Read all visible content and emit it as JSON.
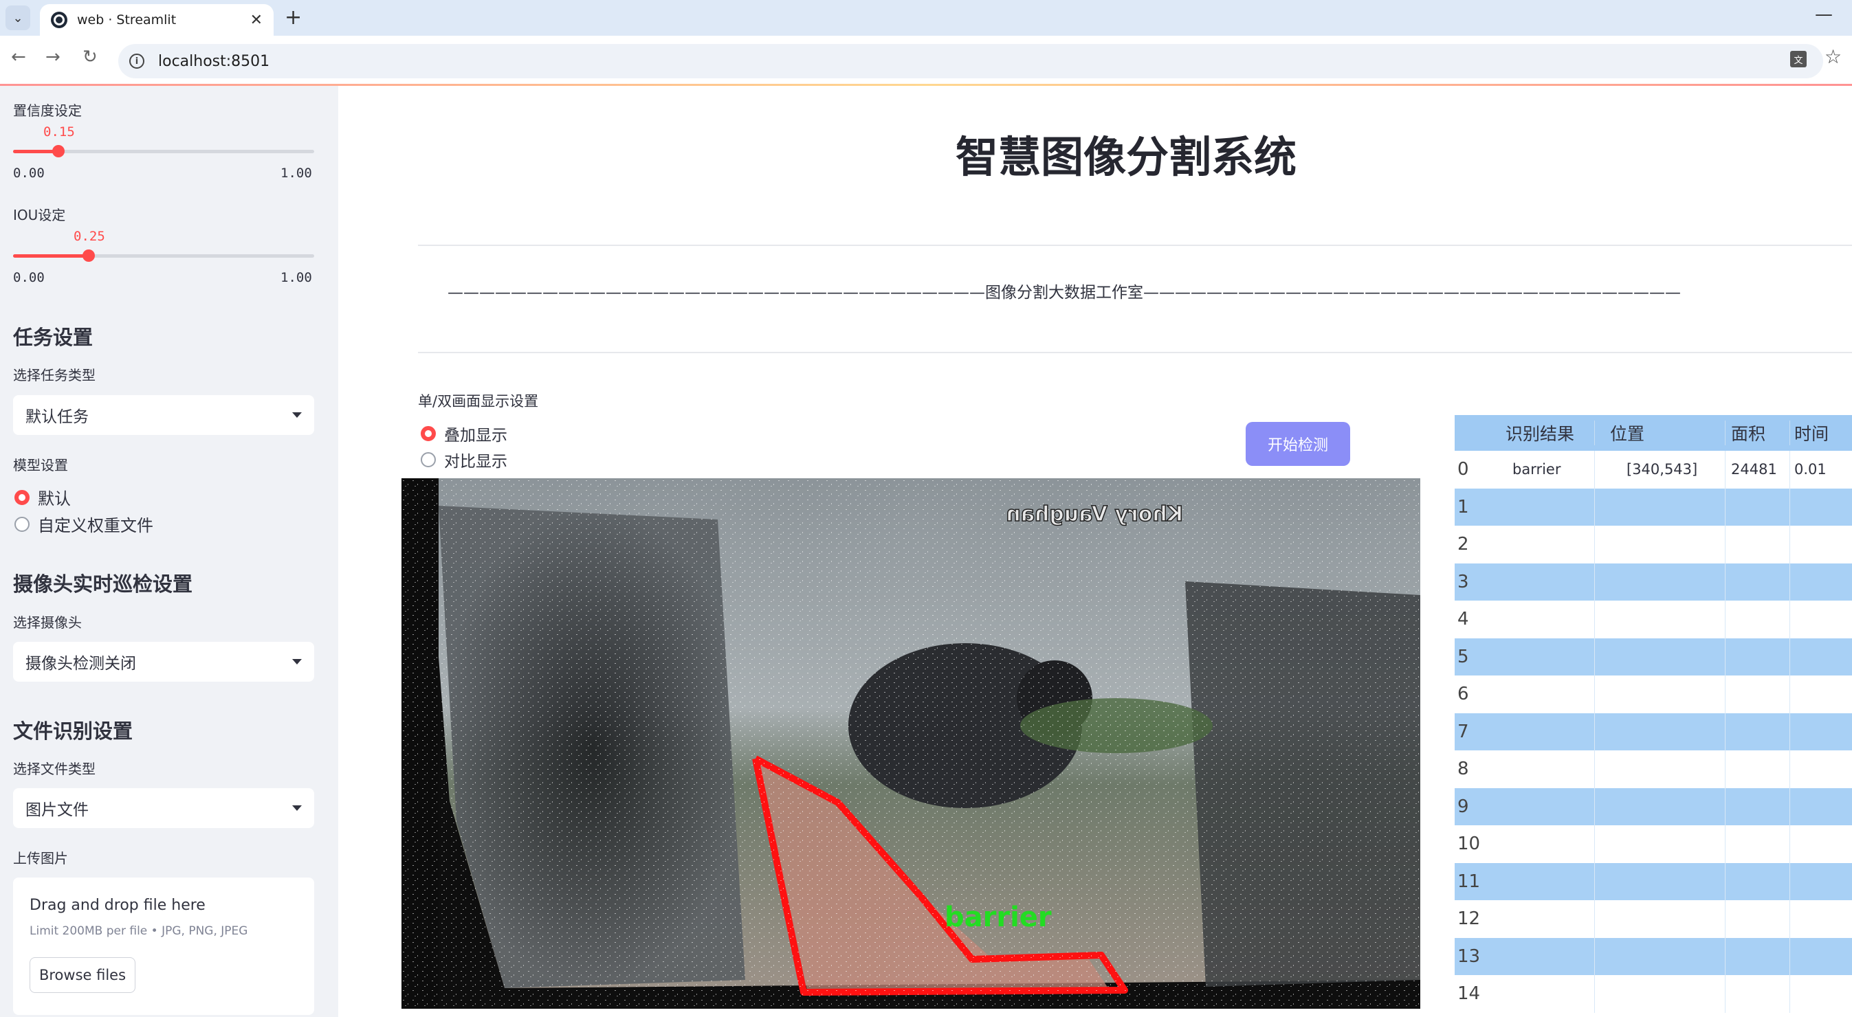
{
  "browser": {
    "tab_title": "web · Streamlit",
    "url": "localhost:8501"
  },
  "sidebar": {
    "confidence": {
      "label": "置信度设定",
      "value": "0.15",
      "value_fraction": 0.15,
      "min": "0.00",
      "max": "1.00"
    },
    "iou": {
      "label": "IOU设定",
      "value": "0.25",
      "value_fraction": 0.25,
      "min": "0.00",
      "max": "1.00"
    },
    "task_section": "任务设置",
    "task_type_label": "选择任务类型",
    "task_type_value": "默认任务",
    "model_label": "模型设置",
    "model_options": [
      "默认",
      "自定义权重文件"
    ],
    "camera_section": "摄像头实时巡检设置",
    "camera_label": "选择摄像头",
    "camera_value": "摄像头检测关闭",
    "file_section": "文件识别设置",
    "file_type_label": "选择文件类型",
    "file_type_value": "图片文件",
    "upload_label": "上传图片",
    "upload_title": "Drag and drop file here",
    "upload_sub": "Limit 200MB per file • JPG, PNG, JPEG",
    "browse_label": "Browse files"
  },
  "main": {
    "title": "智慧图像分割系统",
    "divider_text": "——————————————————————————————————图像分割大数据工作室——————————————————————————————————",
    "display_label": "单/双画面显示设置",
    "display_options": [
      "叠加显示",
      "对比显示"
    ],
    "start_button": "开始检测",
    "watermark": "Khory Vaughan",
    "detection_label": "barrier"
  },
  "table": {
    "headers": [
      "识别结果",
      "位置",
      "面积",
      "时间"
    ],
    "rows": [
      {
        "idx": "0",
        "result": "barrier",
        "pos": "[340,543]",
        "area": "24481",
        "time": "0.01"
      },
      {
        "idx": "1"
      },
      {
        "idx": "2"
      },
      {
        "idx": "3"
      },
      {
        "idx": "4"
      },
      {
        "idx": "5"
      },
      {
        "idx": "6"
      },
      {
        "idx": "7"
      },
      {
        "idx": "8"
      },
      {
        "idx": "9"
      },
      {
        "idx": "10"
      },
      {
        "idx": "11"
      },
      {
        "idx": "12"
      },
      {
        "idx": "13"
      },
      {
        "idx": "14"
      }
    ]
  },
  "colors": {
    "accent": "#ff4b4b",
    "button": "#8b8ef7",
    "table_header": "#9fcaf3",
    "table_alt_row": "#a8d0f5",
    "sidebar_bg": "#f0f2f6"
  }
}
